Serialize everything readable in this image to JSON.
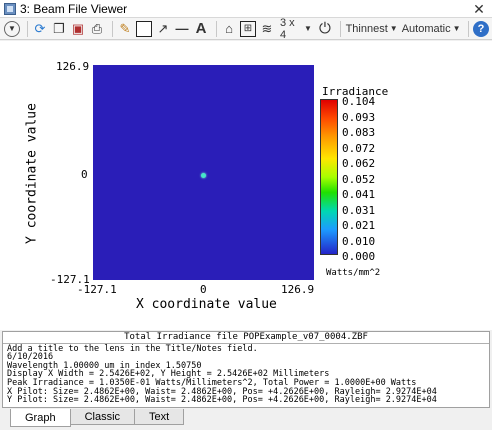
{
  "window": {
    "title": "3: Beam File Viewer",
    "close_glyph": "✕"
  },
  "toolbar": {
    "grid_label": "3 x 4",
    "line_width": "Thinnest",
    "scale_mode": "Automatic",
    "help_label": "?",
    "text_tool": "A"
  },
  "plot": {
    "y_top": "126.9",
    "y_mid": "0",
    "y_bottom": "-127.1",
    "x_left": "-127.1",
    "x_mid": "0",
    "x_right": "126.9",
    "xlabel": "X coordinate value",
    "ylabel": "Y coordinate value"
  },
  "legend": {
    "title": "Irradiance",
    "values": [
      "0.104",
      "0.093",
      "0.083",
      "0.072",
      "0.062",
      "0.052",
      "0.041",
      "0.031",
      "0.021",
      "0.010",
      "0.000"
    ],
    "units": "Watts/mm^2"
  },
  "info": {
    "header": "Total Irradiance file POPExample_v07_0004.ZBF",
    "lines": [
      "Add a title to the lens in the Title/Notes field.",
      "6/10/2016",
      "Wavelength 1.00000 um in index 1.50750",
      "Display X Width = 2.5426E+02, Y Height = 2.5426E+02 Millimeters",
      "Peak Irradiance = 1.0350E-01 Watts/Millimeters^2, Total Power = 1.0000E+00 Watts",
      "X Pilot: Size= 2.4862E+00, Waist= 2.4862E+00, Pos= +4.2626E+00, Rayleigh= 2.9274E+04",
      "Y Pilot: Size= 2.4862E+00, Waist= 2.4862E+00, Pos= +4.2626E+00, Rayleigh= 2.9274E+04"
    ]
  },
  "tabs": [
    "Graph",
    "Classic",
    "Text"
  ]
}
